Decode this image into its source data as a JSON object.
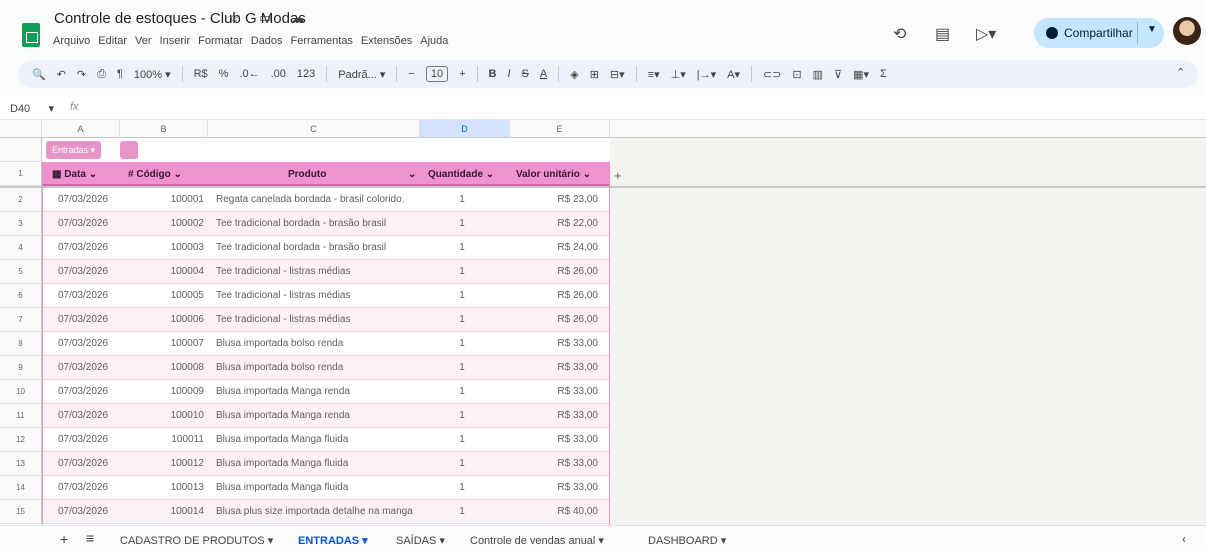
{
  "doc": {
    "title": "Controle de estoques - Club G Modas",
    "title_icons": "☆ ▭ ☁"
  },
  "menu": [
    "Arquivo",
    "Editar",
    "Ver",
    "Inserir",
    "Formatar",
    "Dados",
    "Ferramentas",
    "Extensões",
    "Ajuda"
  ],
  "header": {
    "share_label": "Compartilhar"
  },
  "toolbar": {
    "zoom": "100%",
    "currency": "R$",
    "percent": "%",
    "dec_less": ".0←",
    "dec_more": ".00",
    "num_format": "123",
    "font": "Padrã...",
    "font_size": "10"
  },
  "formula_bar": {
    "cell_ref": "D40",
    "fx": "fx"
  },
  "columns": [
    "A",
    "B",
    "C",
    "D",
    "E"
  ],
  "table": {
    "name": "Entradas",
    "headers": {
      "date": "Data",
      "code": "Código",
      "product": "Produto",
      "qty": "Quantidade",
      "value": "Valor unitário"
    },
    "rows": [
      {
        "n": "2",
        "date": "07/03/2026",
        "code": "100001",
        "product": "Regata canelada bordada - brasil colorido.",
        "qty": "1",
        "value": "R$ 23,00"
      },
      {
        "n": "3",
        "date": "07/03/2026",
        "code": "100002",
        "product": "Tee tradicional bordada - brasão brasil",
        "qty": "1",
        "value": "R$ 22,00"
      },
      {
        "n": "4",
        "date": "07/03/2026",
        "code": "100003",
        "product": "Tee tradicional bordada - brasão brasil",
        "qty": "1",
        "value": "R$ 24,00"
      },
      {
        "n": "5",
        "date": "07/03/2026",
        "code": "100004",
        "product": "Tee tradicional - listras médias",
        "qty": "1",
        "value": "R$ 26,00"
      },
      {
        "n": "6",
        "date": "07/03/2026",
        "code": "100005",
        "product": "Tee tradicional - listras médias",
        "qty": "1",
        "value": "R$ 26,00"
      },
      {
        "n": "7",
        "date": "07/03/2026",
        "code": "100006",
        "product": "Tee tradicional - listras médias",
        "qty": "1",
        "value": "R$ 26,00"
      },
      {
        "n": "8",
        "date": "07/03/2026",
        "code": "100007",
        "product": "Blusa importada bolso renda",
        "qty": "1",
        "value": "R$ 33,00"
      },
      {
        "n": "9",
        "date": "07/03/2026",
        "code": "100008",
        "product": "Blusa importada bolso renda",
        "qty": "1",
        "value": "R$ 33,00"
      },
      {
        "n": "10",
        "date": "07/03/2026",
        "code": "100009",
        "product": "Blusa importada Manga renda",
        "qty": "1",
        "value": "R$ 33,00"
      },
      {
        "n": "11",
        "date": "07/03/2026",
        "code": "100010",
        "product": "Blusa importada Manga renda",
        "qty": "1",
        "value": "R$ 33,00"
      },
      {
        "n": "12",
        "date": "07/03/2026",
        "code": "100011",
        "product": "Blusa importada Manga fluida",
        "qty": "1",
        "value": "R$ 33,00"
      },
      {
        "n": "13",
        "date": "07/03/2026",
        "code": "100012",
        "product": "Blusa importada Manga fluida",
        "qty": "1",
        "value": "R$ 33,00"
      },
      {
        "n": "14",
        "date": "07/03/2026",
        "code": "100013",
        "product": "Blusa importada Manga fluida",
        "qty": "1",
        "value": "R$ 33,00"
      },
      {
        "n": "15",
        "date": "07/03/2026",
        "code": "100014",
        "product": "Blusa plus size importada detalhe na manga",
        "qty": "1",
        "value": "R$ 40,00"
      }
    ]
  },
  "sheets": [
    {
      "label": "CADASTRO DE PRODUTOS",
      "active": false
    },
    {
      "label": "ENTRADAS",
      "active": true
    },
    {
      "label": "SAÍDAS",
      "active": false
    },
    {
      "label": "Controle de vendas anual",
      "active": false
    },
    {
      "label": "DASHBOARD",
      "active": false
    }
  ]
}
